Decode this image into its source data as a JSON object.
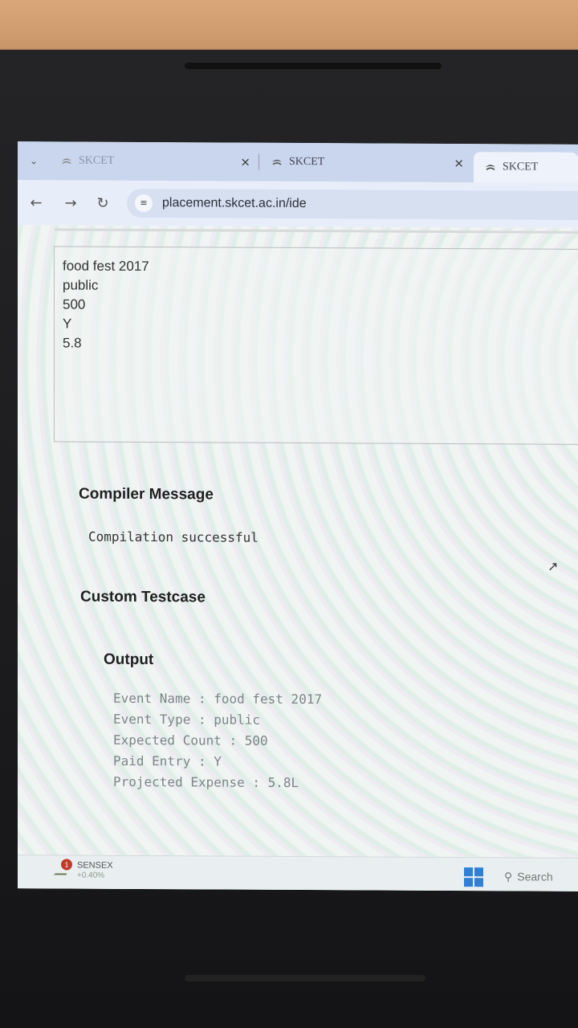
{
  "browser": {
    "tabs": [
      {
        "label": "SKCET"
      },
      {
        "label": "SKCET"
      },
      {
        "label": "SKCET"
      }
    ],
    "url": "placement.skcet.ac.in/ide"
  },
  "input": {
    "lines": [
      "food fest 2017",
      "public",
      "500",
      "Y",
      "5.8"
    ]
  },
  "compiler": {
    "heading": "Compiler Message",
    "message": "Compilation successful"
  },
  "custom_testcase": {
    "heading": "Custom Testcase"
  },
  "output": {
    "heading": "Output",
    "lines": [
      "Event Name : food fest 2017",
      "Event Type : public",
      "Expected Count : 500",
      "Paid Entry : Y",
      "Projected Expense : 5.8L"
    ]
  },
  "taskbar": {
    "sensex_label": "SENSEX",
    "sensex_change": "+0.40%",
    "sensex_badge": "1",
    "search_label": "Search"
  }
}
